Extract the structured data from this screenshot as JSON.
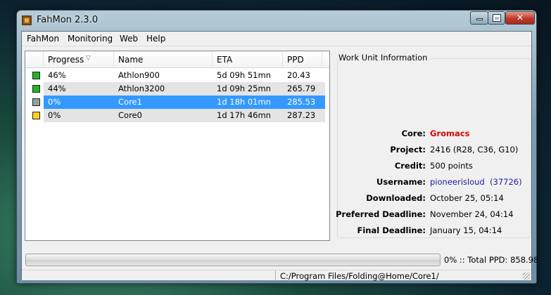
{
  "window": {
    "title": "FahMon 2.3.0"
  },
  "menu": {
    "items": [
      "FahMon",
      "Monitoring",
      "Web",
      "Help"
    ]
  },
  "list": {
    "columns": [
      "Progress",
      "Name",
      "ETA",
      "PPD"
    ],
    "rows": [
      {
        "status_color": "#22b522",
        "progress": "46%",
        "name": "Athlon900",
        "eta": "5d 09h 51mn",
        "ppd": "20.43",
        "selected": false
      },
      {
        "status_color": "#22b522",
        "progress": "44%",
        "name": "Athlon3200",
        "eta": "1d 09h 25mn",
        "ppd": "265.79",
        "selected": false
      },
      {
        "status_color": "#8fa39b",
        "progress": "0%",
        "name": "Core1",
        "eta": "1d 18h 01mn",
        "ppd": "285.53",
        "selected": true
      },
      {
        "status_color": "#ffd21f",
        "progress": "0%",
        "name": "Core0",
        "eta": "1d 17h 46mn",
        "ppd": "287.23",
        "selected": false
      }
    ],
    "selected_color": "#3399ff",
    "alt_row_color": "#e4e4e4"
  },
  "info": {
    "title": "Work Unit Information",
    "core_label": "Core:",
    "core_value": "Gromacs",
    "core_color": "#e00000",
    "project_label": "Project:",
    "project_value": "2416 (R28, C36, G10)",
    "credit_label": "Credit:",
    "credit_value": "500 points",
    "username_label": "Username:",
    "username_value": "pioneerisloud  (37726)",
    "username_color": "#1a1aa8",
    "downloaded_label": "Downloaded:",
    "downloaded_value": "October 25, 05:14",
    "preferred_label": "Preferred Deadline:",
    "preferred_value": "November 24, 04:14",
    "final_label": "Final Deadline:",
    "final_value": "January 15, 04:14"
  },
  "progress": {
    "percent": 0,
    "text": "0% :: Total PPD: 858.98"
  },
  "status": {
    "path": "C:/Program Files/Folding@Home/Core1/"
  }
}
